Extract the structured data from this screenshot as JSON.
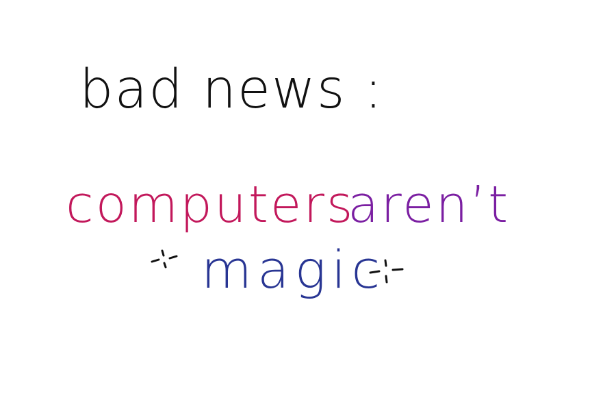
{
  "note": {
    "line1": "bad news :",
    "line2_word1": "computers",
    "line2_word2": "aren’t",
    "line3": "magic"
  },
  "colors": {
    "background": "#ffffff",
    "line1": "#111111",
    "computers": "#c2185b",
    "arent": "#7b1fa2",
    "magic": "#283593",
    "sparkle": "#111111"
  },
  "icons": {
    "left_decoration": "sparkle-icon",
    "right_decoration": "sparkle-icon"
  }
}
